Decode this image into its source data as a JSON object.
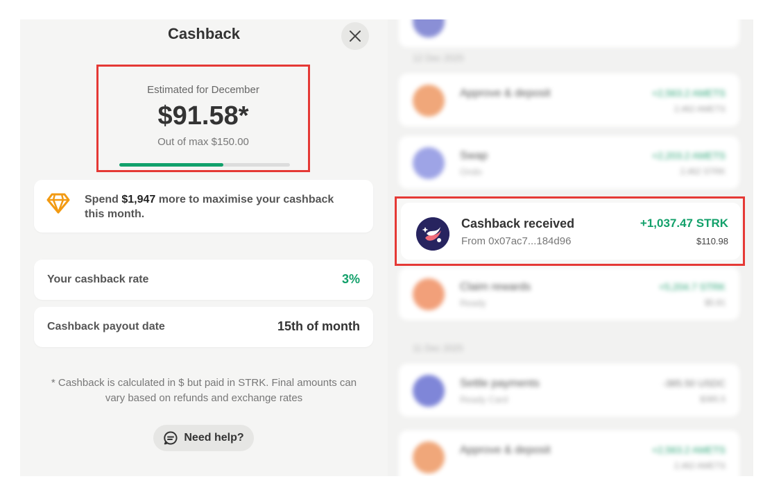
{
  "modal": {
    "title": "Cashback",
    "close_icon": "close-icon",
    "estimate": {
      "label": "Estimated for December",
      "value": "$91.58*",
      "max_text": "Out of max $150.00",
      "progress_fraction": 0.61
    },
    "spend_hint": {
      "icon": "diamond-icon",
      "prefix": "Spend ",
      "amount": "$1,947",
      "suffix": " more to maximise your cashback this month."
    },
    "rate": {
      "label": "Your cashback rate",
      "value": "3%"
    },
    "payout": {
      "label": "Cashback payout date",
      "value": "15th of month"
    },
    "footnote": "* Cashback is calculated in $ but paid in STRK. Final amounts can vary based on refunds and exchange rates",
    "help_button": "Need help?"
  },
  "activity": {
    "highlighted": {
      "title": "Cashback received",
      "subtitle": "From 0x07ac7...184d96",
      "amount": "+1,037.47 STRK",
      "usd": "$110.98"
    },
    "blurred": {
      "date1": "12 Dec 2025",
      "date2": "11 Dec 2025",
      "items": [
        {
          "title": "Approve & deposit",
          "amount": "+2,563.2 AMETS",
          "usd": "2,462 AMETS"
        },
        {
          "title": "Swap",
          "sub": "Ondo",
          "amount": "+2,203.2 AMETS",
          "usd": "2,462 STRK"
        },
        {
          "title": "Claim rewards",
          "sub": "Ready",
          "amount": "+5,204.7 STRK",
          "usd": "$5.81"
        },
        {
          "title": "Settle payments",
          "sub": "Ready Card",
          "amount": "-385.50 USDC",
          "usd": "$385.5"
        },
        {
          "title": "Approve & deposit",
          "amount": "+2,563.2 AMETS",
          "usd": "2,462 AMETS"
        }
      ]
    }
  },
  "colors": {
    "accent_green": "#12a06a",
    "highlight_red": "#e53935"
  }
}
